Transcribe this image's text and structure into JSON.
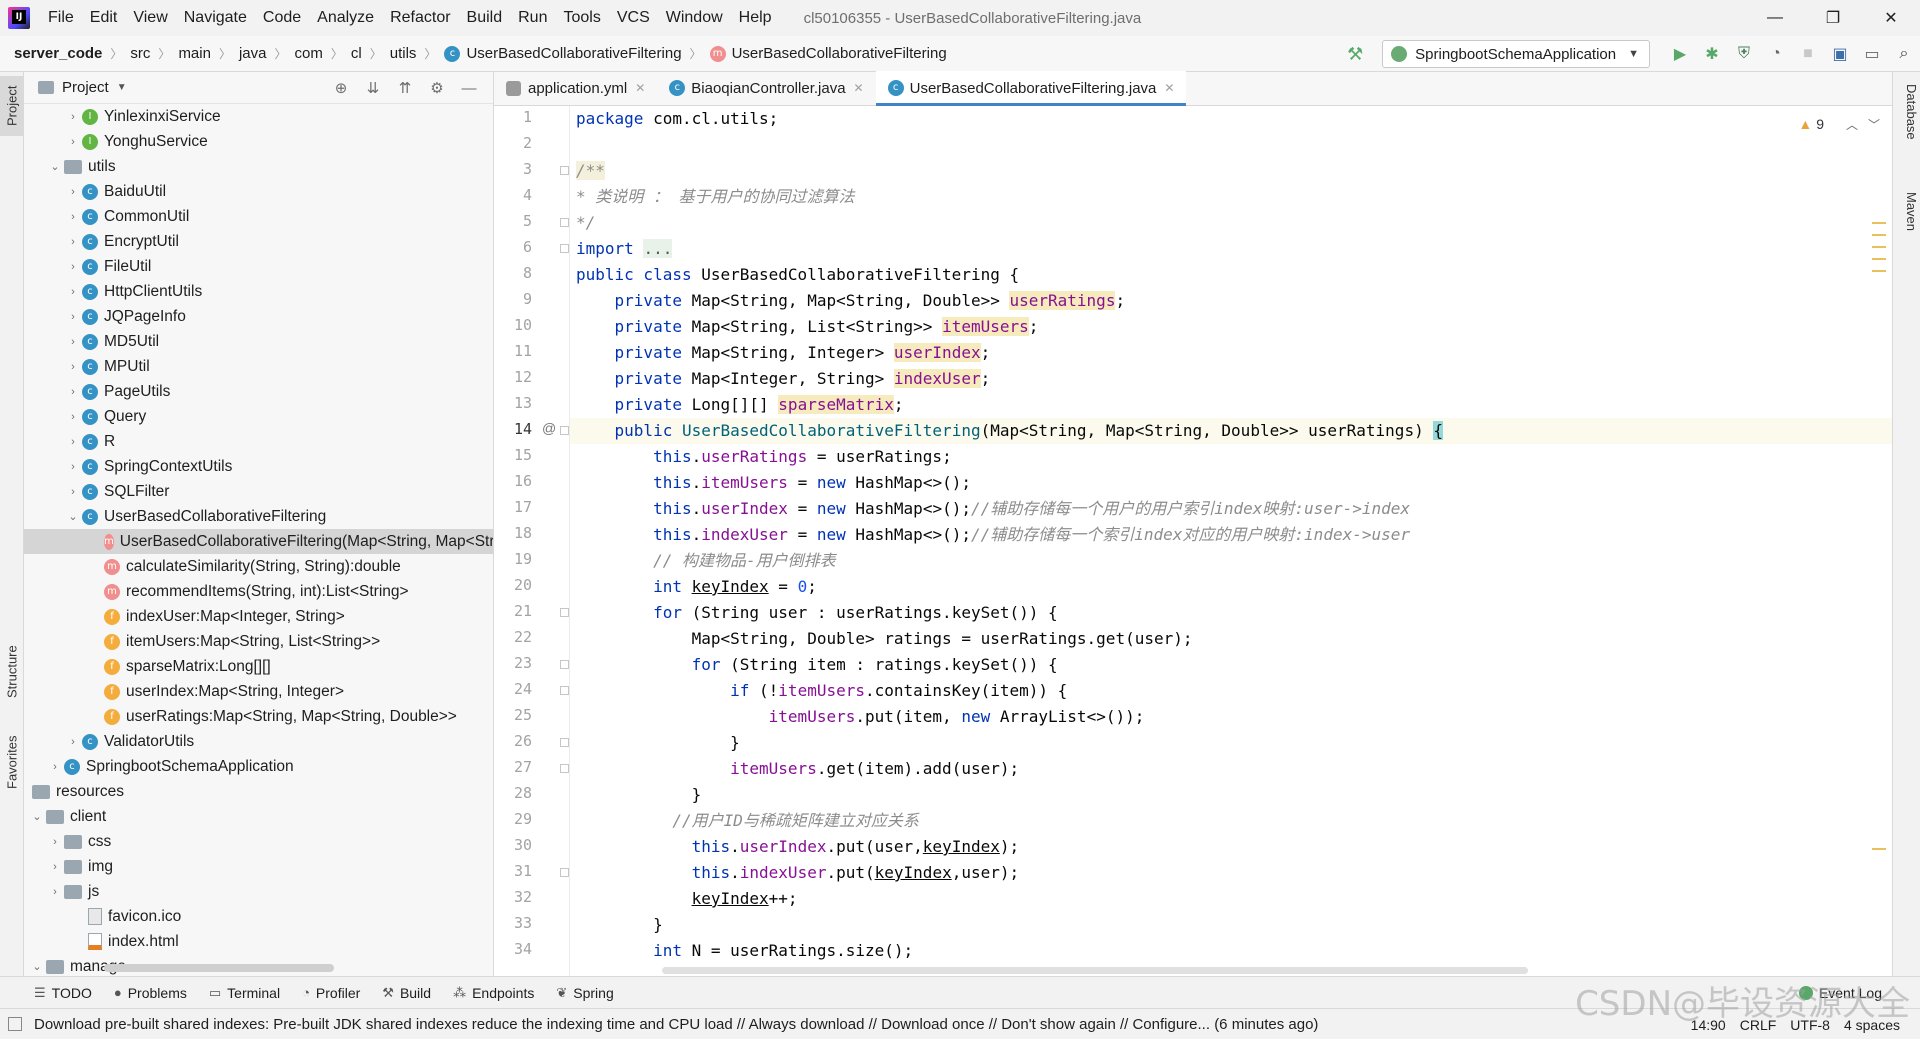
{
  "menu": {
    "items": [
      "File",
      "Edit",
      "View",
      "Navigate",
      "Code",
      "Analyze",
      "Refactor",
      "Build",
      "Run",
      "Tools",
      "VCS",
      "Window",
      "Help"
    ],
    "window_title": "cl50106355 - UserBasedCollaborativeFiltering.java"
  },
  "breadcrumb": [
    "server_code",
    "src",
    "main",
    "java",
    "com",
    "cl",
    "utils",
    "UserBasedCollaborativeFiltering",
    "UserBasedCollaborativeFiltering"
  ],
  "run_config": "SpringbootSchemaApplication",
  "left_tabs": [
    "Project",
    "Structure",
    "Favorites"
  ],
  "right_tabs": [
    "Database",
    "Maven"
  ],
  "project_panel": {
    "title": "Project",
    "tree": [
      {
        "label": "YinlexinxiService",
        "icon": "interface-icon"
      },
      {
        "label": "YonghuService",
        "icon": "interface-icon"
      },
      {
        "label": "utils",
        "icon": "folder-icon"
      },
      {
        "label": "BaiduUtil",
        "icon": "class-icon"
      },
      {
        "label": "CommonUtil",
        "icon": "class-icon"
      },
      {
        "label": "EncryptUtil",
        "icon": "class-icon"
      },
      {
        "label": "FileUtil",
        "icon": "class-icon"
      },
      {
        "label": "HttpClientUtils",
        "icon": "class-icon"
      },
      {
        "label": "JQPageInfo",
        "icon": "class-icon"
      },
      {
        "label": "MD5Util",
        "icon": "class-icon"
      },
      {
        "label": "MPUtil",
        "icon": "class-icon"
      },
      {
        "label": "PageUtils",
        "icon": "class-icon"
      },
      {
        "label": "Query",
        "icon": "class-icon"
      },
      {
        "label": "R",
        "icon": "class-icon"
      },
      {
        "label": "SpringContextUtils",
        "icon": "class-icon"
      },
      {
        "label": "SQLFilter",
        "icon": "class-icon"
      },
      {
        "label": "UserBasedCollaborativeFiltering",
        "icon": "class-icon"
      },
      {
        "label": "UserBasedCollaborativeFiltering(Map<String, Map<String, Double>>)",
        "icon": "method-icon"
      },
      {
        "label": "calculateSimilarity(String, String):double",
        "icon": "method-icon"
      },
      {
        "label": "recommendItems(String, int):List<String>",
        "icon": "method-icon"
      },
      {
        "label": "indexUser:Map<Integer, String>",
        "icon": "field-icon"
      },
      {
        "label": "itemUsers:Map<String, List<String>>",
        "icon": "field-icon"
      },
      {
        "label": "sparseMatrix:Long[][]",
        "icon": "field-icon"
      },
      {
        "label": "userIndex:Map<String, Integer>",
        "icon": "field-icon"
      },
      {
        "label": "userRatings:Map<String, Map<String, Double>>",
        "icon": "field-icon"
      },
      {
        "label": "ValidatorUtils",
        "icon": "class-icon"
      },
      {
        "label": "SpringbootSchemaApplication",
        "icon": "class-icon"
      },
      {
        "label": "resources",
        "icon": "folder-icon"
      },
      {
        "label": "client",
        "icon": "folder-icon"
      },
      {
        "label": "css",
        "icon": "folder-icon"
      },
      {
        "label": "img",
        "icon": "folder-icon"
      },
      {
        "label": "js",
        "icon": "folder-icon"
      },
      {
        "label": "favicon.ico",
        "icon": "file-icon"
      },
      {
        "label": "index.html",
        "icon": "html-icon"
      },
      {
        "label": "manage",
        "icon": "folder-icon"
      }
    ]
  },
  "editor": {
    "tabs": [
      "application.yml",
      "BiaoqianController.java",
      "UserBasedCollaborativeFiltering.java"
    ],
    "warning_count": "9",
    "line_numbers": [
      "1",
      "2",
      "3",
      "4",
      "5",
      "6",
      "8",
      "9",
      "10",
      "11",
      "12",
      "13",
      "14",
      "15",
      "16",
      "17",
      "18",
      "19",
      "20",
      "21",
      "22",
      "23",
      "24",
      "25",
      "26",
      "27",
      "28",
      "29",
      "30",
      "31",
      "32",
      "33",
      "34"
    ]
  },
  "tool_windows": [
    "TODO",
    "Problems",
    "Terminal",
    "Profiler",
    "Build",
    "Endpoints",
    "Spring"
  ],
  "event_log": "Event Log",
  "status": {
    "message": "Download pre-built shared indexes: Pre-built JDK shared indexes reduce the indexing time and CPU load // Always download // Download once // Don't show again // Configure... (6 minutes ago)",
    "position": "14:90",
    "line_sep": "CRLF",
    "encoding": "UTF-8",
    "indent": "4 spaces"
  },
  "watermark": "CSDN@毕设资源大全"
}
